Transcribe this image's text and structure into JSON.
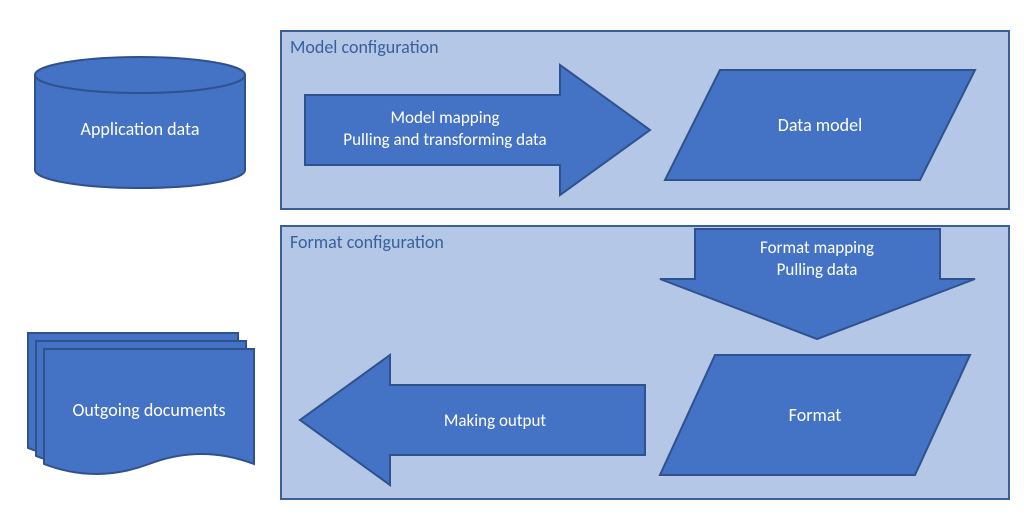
{
  "panels": {
    "model": {
      "title": "Model configuration"
    },
    "format": {
      "title": "Format configuration"
    }
  },
  "shapes": {
    "application_data": "Application data",
    "outgoing_documents": "Outgoing documents",
    "data_model": "Data model",
    "format": "Format"
  },
  "arrows": {
    "model_mapping": {
      "line1": "Model mapping",
      "line2": "Pulling and transforming data"
    },
    "format_mapping": {
      "line1": "Format mapping",
      "line2": "Pulling data"
    },
    "making_output": "Making output"
  },
  "colors": {
    "fill": "#4472c4",
    "stroke": "#2f528f",
    "panel_bg": "#b4c7e7",
    "panel_border": "#3a5f9a",
    "panel_text": "#3a5f9a"
  }
}
